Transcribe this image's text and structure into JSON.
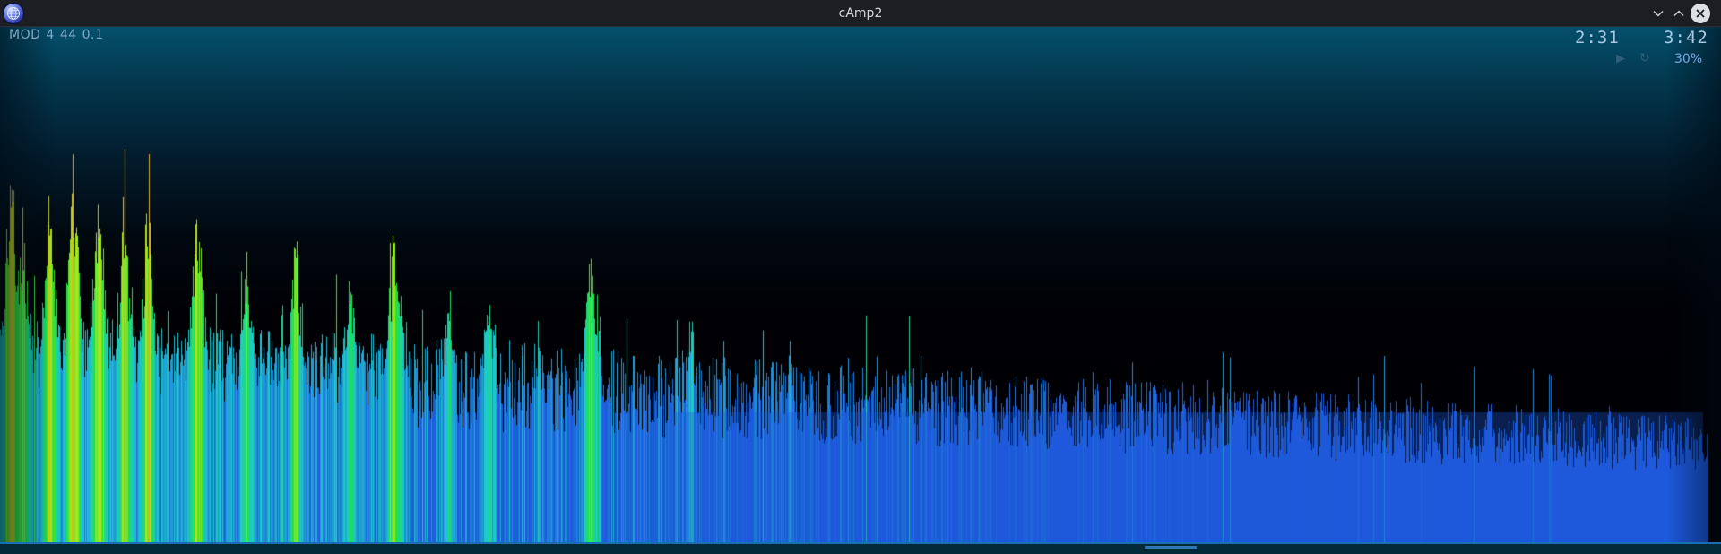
{
  "window": {
    "title": "cAmp2",
    "icon": "globe-app-icon",
    "buttons": {
      "minimize_icon": "chevron-down-icon",
      "maximize_icon": "chevron-up-icon",
      "close_icon": "close-icon"
    }
  },
  "track": {
    "format": "MOD",
    "channels": "4",
    "sample_rate": "44",
    "version": "0.1"
  },
  "playback": {
    "elapsed": "2:31",
    "total": "3:42",
    "volume": "30%",
    "play_icon": "▶",
    "repeat_icon": "↻",
    "progress_fraction": 0.68
  },
  "colors": {
    "background_top": "#04506c",
    "background_bottom": "#000003",
    "bar_low": "#1c58d8",
    "bar_mid": "#14c8d8",
    "bar_green": "#20e040",
    "bar_yellow": "#d8f020",
    "bar_orange": "#f0a020",
    "accent": "#74a7ea"
  }
}
